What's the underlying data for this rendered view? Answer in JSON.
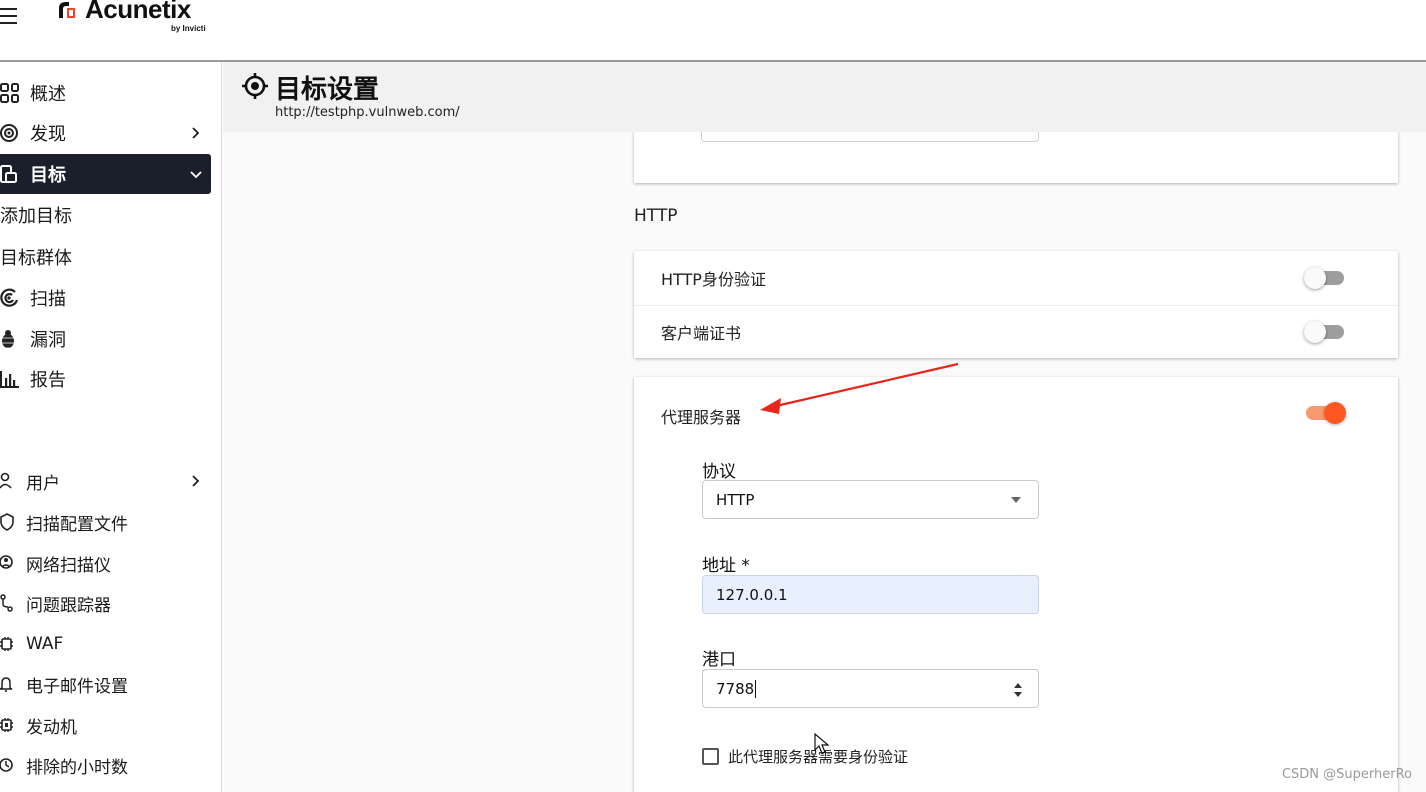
{
  "header": {
    "brand_name": "Acunetix",
    "brand_sub": "by Invicti"
  },
  "sidebar": {
    "items": [
      {
        "label": "概述",
        "icon": "overview-grid-icon"
      },
      {
        "label": "发现",
        "icon": "discovery-target-icon"
      },
      {
        "label": "目标",
        "icon": "targets-icon",
        "active": true
      },
      {
        "label": "添加目标"
      },
      {
        "label": "目标群体"
      },
      {
        "label": "扫描",
        "icon": "scan-radar-icon"
      },
      {
        "label": "漏洞",
        "icon": "bug-icon"
      },
      {
        "label": "报告",
        "icon": "bar-chart-icon"
      },
      {
        "label": "用户",
        "icon": "user-icon"
      },
      {
        "label": "扫描配置文件",
        "icon": "shield-icon"
      },
      {
        "label": "网络扫描仪",
        "icon": "network-scanner-icon"
      },
      {
        "label": "问题跟踪器",
        "icon": "issue-tracker-icon"
      },
      {
        "label": "WAF",
        "icon": "chip-icon"
      },
      {
        "label": "电子邮件设置",
        "icon": "bell-icon"
      },
      {
        "label": "发动机",
        "icon": "engine-chip-icon"
      },
      {
        "label": "排除的小时数",
        "icon": "clock-icon"
      }
    ]
  },
  "page": {
    "title": "目标设置",
    "url": "http://testphp.vulnweb.com/"
  },
  "http_section": {
    "title": "HTTP",
    "http_auth_label": "HTTP身份验证",
    "http_auth_enabled": false,
    "client_cert_label": "客户端证书",
    "client_cert_enabled": false
  },
  "proxy": {
    "label": "代理服务器",
    "enabled": true,
    "protocol_label": "协议",
    "protocol_value": "HTTP",
    "address_label": "地址 *",
    "address_value": "127.0.0.1",
    "port_label": "港口",
    "port_value": "7788",
    "auth_checkbox_label": "此代理服务器需要身份验证",
    "auth_checkbox_checked": false
  },
  "colors": {
    "accent": "#ff5722",
    "sidebar_active_bg": "#1b1f2b",
    "annotation_arrow": "#e8261c"
  },
  "watermark": "CSDN @SuperherRo"
}
